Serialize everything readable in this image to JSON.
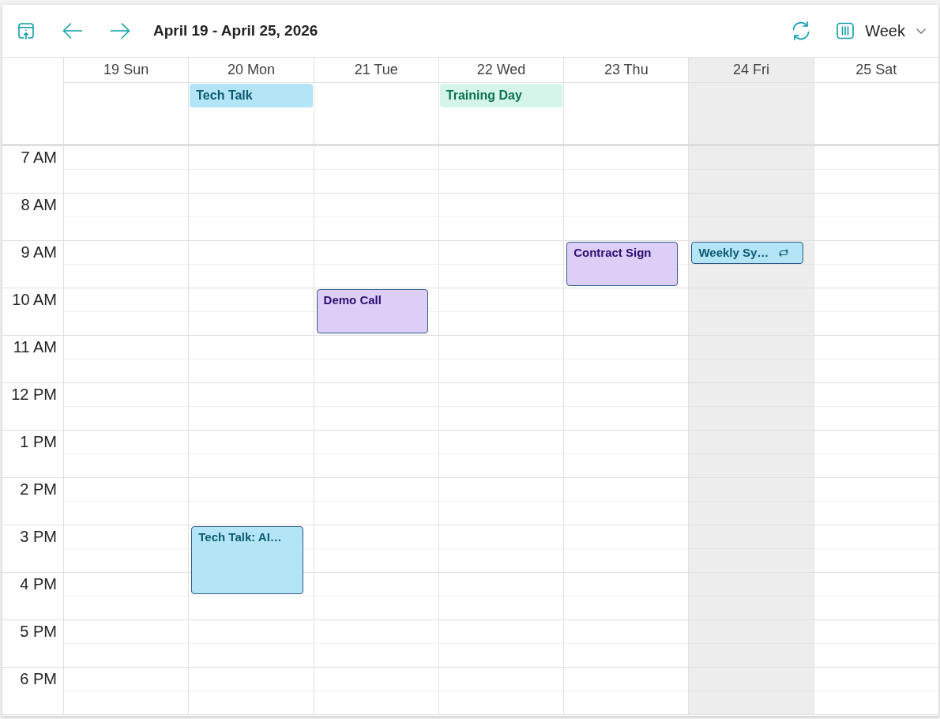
{
  "toolbar": {
    "title": "April 19 - April 25, 2026",
    "view": "Week"
  },
  "time_slots": [
    "7 AM",
    "8 AM",
    "9 AM",
    "10 AM",
    "11 AM",
    "12 PM",
    "1 PM",
    "2 PM",
    "3 PM",
    "4 PM",
    "5 PM",
    "6 PM"
  ],
  "days": [
    {
      "label": "19 Sun",
      "selected": false,
      "slots": [
        {
          "kind": "hour"
        },
        {
          "kind": "hour"
        },
        {
          "kind": "hour"
        },
        {
          "kind": "hour"
        },
        {
          "kind": "hour"
        },
        {
          "kind": "hour"
        },
        {
          "kind": "hour"
        },
        {
          "kind": "hour"
        },
        {
          "kind": "hour"
        },
        {
          "kind": "hour"
        },
        {
          "kind": "hour"
        },
        {
          "kind": "hour"
        }
      ]
    },
    {
      "label": "20 Mon",
      "selected": false,
      "all_day_events": [
        {
          "title": "Tech Talk",
          "color": "#b3e5f6"
        }
      ],
      "slots": [
        {
          "kind": "hour"
        },
        {
          "kind": "hour"
        },
        {
          "kind": "hour"
        },
        {
          "kind": "hour"
        },
        {
          "kind": "hour"
        },
        {
          "kind": "hour"
        },
        {
          "kind": "hour"
        },
        {
          "kind": "hour"
        },
        {
          "kind": "hour-and-half",
          "events": [
            {
              "title": "Tech Talk: AI…",
              "color": "#b3e5f6",
              "recurring": false
            }
          ]
        },
        {
          "kind": "half-hour"
        },
        {
          "kind": "hour"
        },
        {
          "kind": "hour"
        }
      ]
    },
    {
      "label": "21 Tue",
      "selected": false,
      "slots": [
        {
          "kind": "hour"
        },
        {
          "kind": "hour"
        },
        {
          "kind": "hour"
        },
        {
          "kind": "hour",
          "events": [
            {
              "title": "Demo Call",
              "color": "#dccef7",
              "recurring": false
            }
          ]
        },
        {
          "kind": "hour"
        },
        {
          "kind": "hour"
        },
        {
          "kind": "hour"
        },
        {
          "kind": "hour"
        },
        {
          "kind": "hour"
        },
        {
          "kind": "hour"
        },
        {
          "kind": "hour"
        },
        {
          "kind": "hour"
        }
      ]
    },
    {
      "label": "22 Wed",
      "selected": false,
      "all_day_events": [
        {
          "title": "Training Day",
          "color": "#d5f5ea"
        }
      ],
      "slots": [
        {
          "kind": "hour"
        },
        {
          "kind": "hour"
        },
        {
          "kind": "hour"
        },
        {
          "kind": "hour"
        },
        {
          "kind": "hour"
        },
        {
          "kind": "hour"
        },
        {
          "kind": "hour"
        },
        {
          "kind": "hour"
        },
        {
          "kind": "hour"
        },
        {
          "kind": "hour"
        },
        {
          "kind": "hour"
        },
        {
          "kind": "hour"
        }
      ]
    },
    {
      "label": "23 Thu",
      "selected": false,
      "slots": [
        {
          "kind": "hour"
        },
        {
          "kind": "hour"
        },
        {
          "kind": "hour",
          "events": [
            {
              "title": "Contract Sign",
              "color": "#dccef7",
              "recurring": false
            }
          ]
        },
        {
          "kind": "hour"
        },
        {
          "kind": "hour"
        },
        {
          "kind": "hour"
        },
        {
          "kind": "hour"
        },
        {
          "kind": "hour"
        },
        {
          "kind": "hour"
        },
        {
          "kind": "hour"
        },
        {
          "kind": "hour"
        },
        {
          "kind": "hour"
        }
      ]
    },
    {
      "label": "24 Fri",
      "selected": true,
      "slots": [
        {
          "kind": "hour"
        },
        {
          "kind": "hour"
        },
        {
          "kind": "half-hour",
          "events": [
            {
              "title": "Weekly Sy…",
              "color": "#b3e5f6",
              "recurring": true
            }
          ]
        },
        {
          "kind": "half-hour"
        },
        {
          "kind": "hour"
        },
        {
          "kind": "hour"
        },
        {
          "kind": "hour"
        },
        {
          "kind": "hour"
        },
        {
          "kind": "hour"
        },
        {
          "kind": "hour"
        },
        {
          "kind": "hour"
        },
        {
          "kind": "hour"
        },
        {
          "kind": "hour"
        }
      ]
    },
    {
      "label": "25 Sat",
      "selected": false,
      "slots": [
        {
          "kind": "hour"
        },
        {
          "kind": "hour"
        },
        {
          "kind": "hour"
        },
        {
          "kind": "hour"
        },
        {
          "kind": "hour"
        },
        {
          "kind": "hour"
        },
        {
          "kind": "hour"
        },
        {
          "kind": "hour"
        },
        {
          "kind": "hour"
        },
        {
          "kind": "hour"
        },
        {
          "kind": "hour"
        },
        {
          "kind": "hour"
        }
      ]
    }
  ]
}
